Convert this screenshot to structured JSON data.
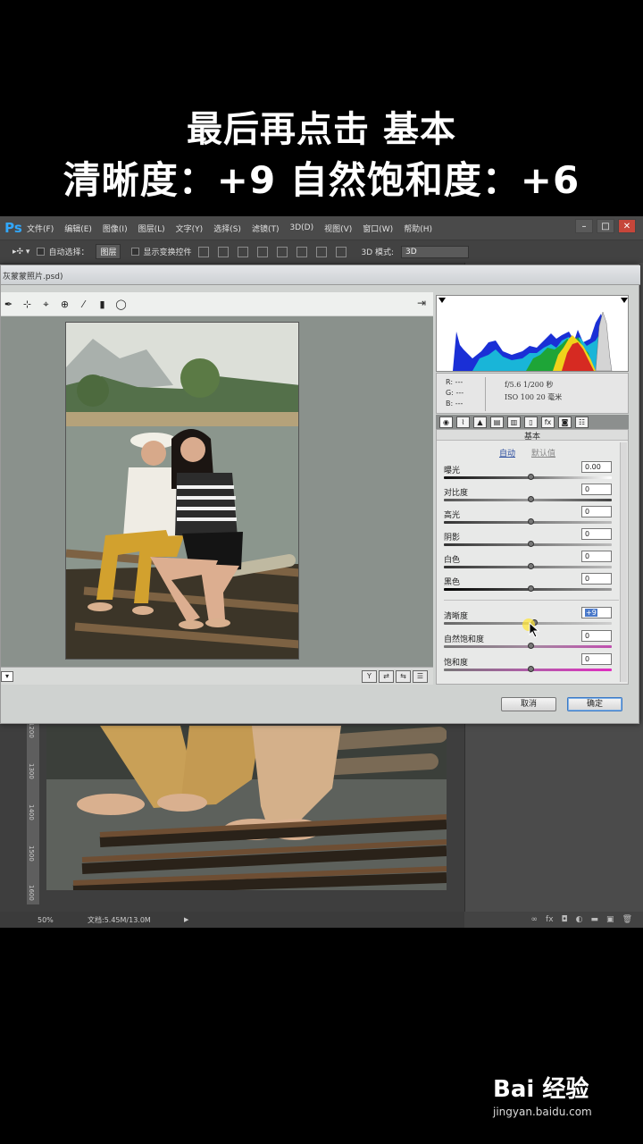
{
  "caption": {
    "line1": "最后再点击 基本",
    "line2": "清晰度：+9  自然饱和度：+6"
  },
  "app": {
    "logo": "Ps",
    "menu": [
      "文件(F)",
      "编辑(E)",
      "图像(I)",
      "图层(L)",
      "文字(Y)",
      "选择(S)",
      "滤镜(T)",
      "3D(D)",
      "视图(V)",
      "窗口(W)",
      "帮助(H)"
    ],
    "options": {
      "auto_select_label": "自动选择：",
      "auto_select_value": "图层",
      "show_transform_label": "显示变换控件",
      "mode_label": "3D 模式:",
      "mode_value": "3D"
    },
    "status": {
      "zoom": "50%",
      "doc": "文档:5.45M/13.0M"
    },
    "ruler_marks": [
      "1200",
      "1300",
      "1400",
      "1500",
      "1600"
    ]
  },
  "dialog": {
    "title": "灰蒙蒙照片.psd)",
    "readout": {
      "r": "R:  ---",
      "g": "G:  ---",
      "b": "B:  ---",
      "exif1": "f/5.6   1/200 秒",
      "exif2": "ISO 100   20 毫米"
    },
    "panel_title": "基本",
    "auto_link": "自动",
    "default_link": "默认值",
    "sliders": [
      {
        "label": "曝光",
        "value": "0.00"
      },
      {
        "label": "对比度",
        "value": "0"
      },
      {
        "label": "高光",
        "value": "0"
      },
      {
        "label": "阴影",
        "value": "0"
      },
      {
        "label": "白色",
        "value": "0"
      },
      {
        "label": "黑色",
        "value": "0"
      },
      {
        "label": "清晰度",
        "value": "+9"
      },
      {
        "label": "自然饱和度",
        "value": "0"
      },
      {
        "label": "饱和度",
        "value": "0"
      }
    ],
    "cancel": "取消",
    "ok": "确定"
  },
  "watermark": {
    "main": "Bai 经验",
    "sub": "jingyan.baidu.com"
  }
}
